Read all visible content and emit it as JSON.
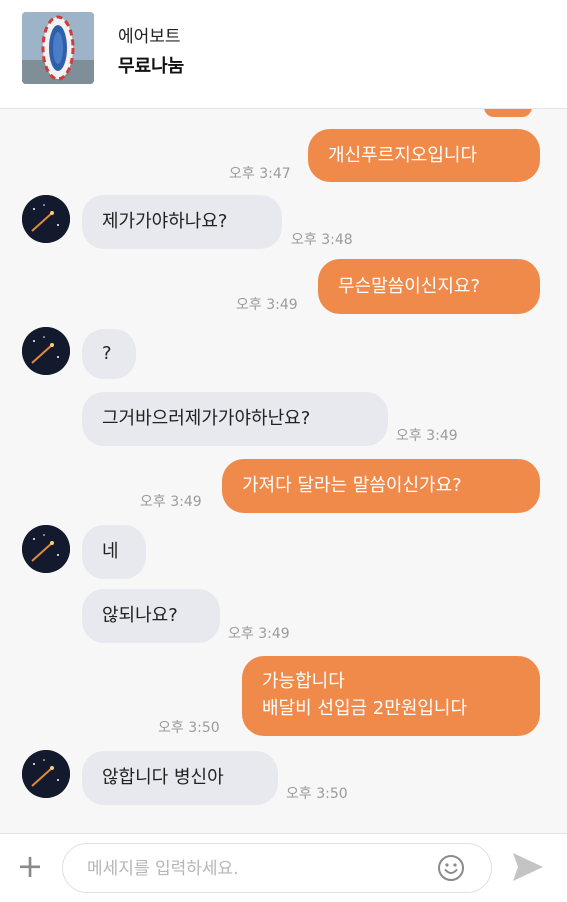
{
  "header": {
    "item_title": "에어보트",
    "item_status": "무료나눔"
  },
  "messages": [
    {
      "side": "out",
      "text": "개신푸르지오입니다",
      "time": "오후 3:47"
    },
    {
      "side": "in",
      "text": "제가가야하나요?",
      "time": "오후 3:48"
    },
    {
      "side": "out",
      "text": "무슨말씀이신지요?",
      "time": "오후 3:49"
    },
    {
      "side": "in",
      "text": "?",
      "time": ""
    },
    {
      "side": "in",
      "text": "그거바으러제가가야하난요?",
      "time": "오후 3:49"
    },
    {
      "side": "out",
      "text": "가져다 달라는 말씀이신가요?",
      "time": "오후 3:49"
    },
    {
      "side": "in",
      "text": "네",
      "time": ""
    },
    {
      "side": "in",
      "text": "않되나요?",
      "time": "오후 3:49"
    },
    {
      "side": "out",
      "lines": [
        "가능합니다",
        "배달비 선입금 2만원입니다"
      ],
      "time": "오후 3:50"
    },
    {
      "side": "in",
      "text": "않합니다 병신아",
      "time": "오후 3:50"
    }
  ],
  "composer": {
    "placeholder": "메세지를 입력하세요.",
    "plus_label": "+"
  },
  "icons": {
    "plus": "plus-icon",
    "emoji": "smiley-icon",
    "send": "send-icon",
    "avatar": "night-sky-avatar",
    "thumbnail": "air-boat-photo"
  },
  "colors": {
    "outgoing_bubble": "#f08a4b",
    "incoming_bubble": "#e8e9ee",
    "timestamp": "#9b9b9b"
  }
}
